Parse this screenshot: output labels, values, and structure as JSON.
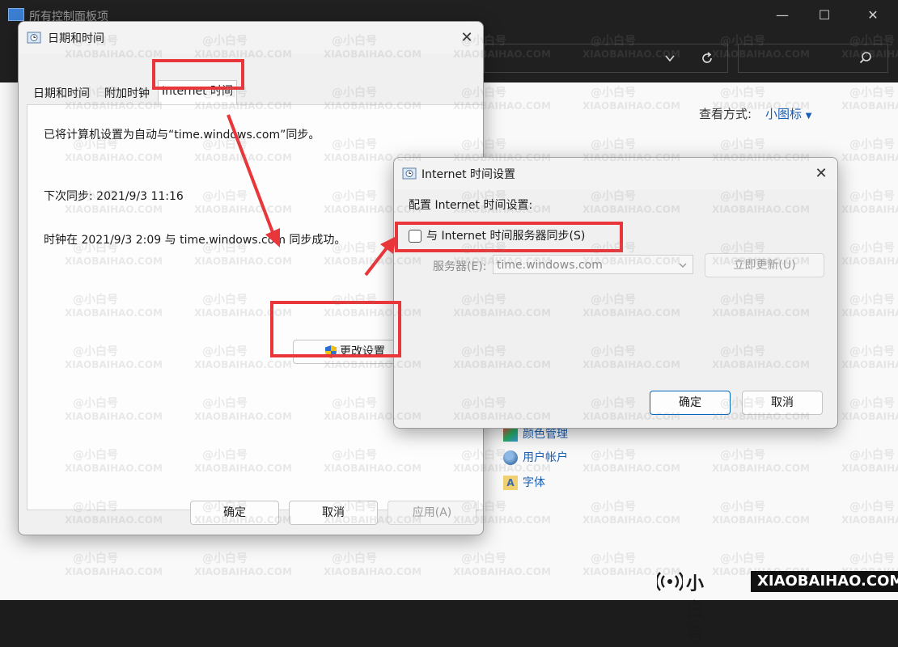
{
  "control_panel": {
    "title": "所有控制面板项",
    "view_label": "查看方式:",
    "view_value": "小图标",
    "items": [
      {
        "label": "颜色管理",
        "icon": "color-management-icon"
      },
      {
        "label": "用户帐户",
        "icon": "user-accounts-icon"
      },
      {
        "label": "字体",
        "icon": "fonts-icon"
      }
    ],
    "window_controls": {
      "minimize": "—",
      "maximize": "☐",
      "close": "✕"
    }
  },
  "datetime_dialog": {
    "title": "日期和时间",
    "tabs": [
      {
        "label": "日期和时间",
        "active": false
      },
      {
        "label": "附加时钟",
        "active": false
      },
      {
        "label": "Internet 时间",
        "active": true
      }
    ],
    "sync_status": "已将计算机设置为自动与“time.windows.com”同步。",
    "next_sync": "下次同步: 2021/9/3 11:16",
    "last_sync": "时钟在 2021/9/3 2:09 与 time.windows.com 同步成功。",
    "change_settings_label": "更改设置",
    "ok_label": "确定",
    "cancel_label": "取消",
    "apply_label": "应用(A)"
  },
  "internet_time_dialog": {
    "title": "Internet 时间设置",
    "config_label": "配置 Internet 时间设置:",
    "sync_checkbox_label": "与 Internet 时间服务器同步(S)",
    "sync_checked": false,
    "server_label": "服务器(E):",
    "server_value": "time.windows.com",
    "update_now_label": "立即更新(U)",
    "ok_label": "确定",
    "cancel_label": "取消"
  },
  "watermark": {
    "cn": "@小白号",
    "en": "XIAOBAIHAO.COM"
  },
  "logo": {
    "cn": "小白号",
    "en": "XIAOBAIHAO.COM"
  },
  "colors": {
    "highlight_red": "#e8363a",
    "link_blue": "#1a5fb4",
    "accent_blue": "#0067c0"
  }
}
